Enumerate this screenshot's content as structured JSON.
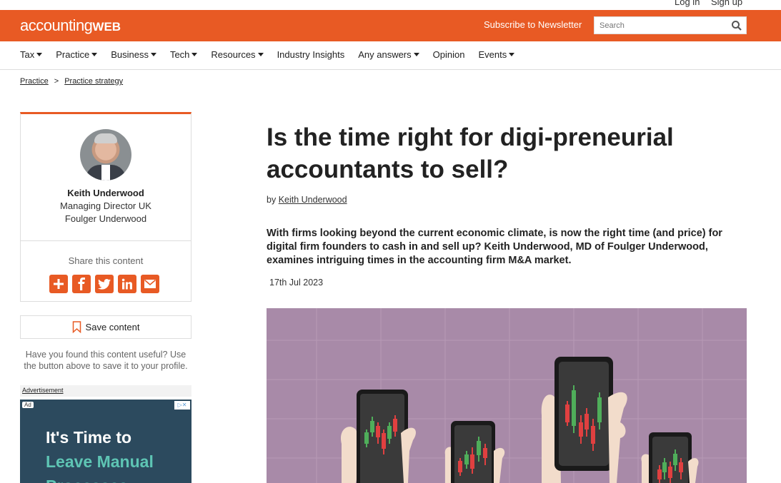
{
  "topbar": {
    "login": "Log in",
    "signup": "Sign up"
  },
  "header": {
    "logo_main": "accounting",
    "logo_bold": "WEB",
    "subscribe": "Subscribe to Newsletter",
    "search_placeholder": "Search",
    "brand_color": "#e85a24"
  },
  "nav": {
    "items": [
      {
        "label": "Tax",
        "dropdown": true
      },
      {
        "label": "Practice",
        "dropdown": true
      },
      {
        "label": "Business",
        "dropdown": true
      },
      {
        "label": "Tech",
        "dropdown": true
      },
      {
        "label": "Resources",
        "dropdown": true
      },
      {
        "label": "Industry Insights",
        "dropdown": false
      },
      {
        "label": "Any answers",
        "dropdown": true
      },
      {
        "label": "Opinion",
        "dropdown": false
      },
      {
        "label": "Events",
        "dropdown": true
      }
    ]
  },
  "breadcrumb": {
    "items": [
      "Practice",
      "Practice strategy"
    ],
    "separator": ">"
  },
  "author": {
    "name": "Keith Underwood",
    "role": "Managing Director UK",
    "company": "Foulger Underwood",
    "share_label": "Share this content",
    "share_icons": [
      "plus-icon",
      "facebook-icon",
      "twitter-icon",
      "linkedin-icon",
      "email-icon"
    ]
  },
  "save": {
    "label": "Save content",
    "note": "Have you found this content useful? Use the button above to save it to your profile."
  },
  "ad": {
    "label": "Advertisement",
    "tag": "Ad",
    "line1": "It's Time to",
    "line2": "Leave Manual",
    "line3": "Processes"
  },
  "article": {
    "title": "Is the time right for digi-preneurial accountants to sell?",
    "by_prefix": "by",
    "author_link": "Keith Underwood",
    "standfirst": "With firms looking beyond the current economic climate, is now the right time (and price) for digital firm founders to cash in and sell up? Keith Underwood, MD of Foulger Underwood, examines intriguing times in the accounting firm M&A market.",
    "date": "17th Jul 2023"
  }
}
